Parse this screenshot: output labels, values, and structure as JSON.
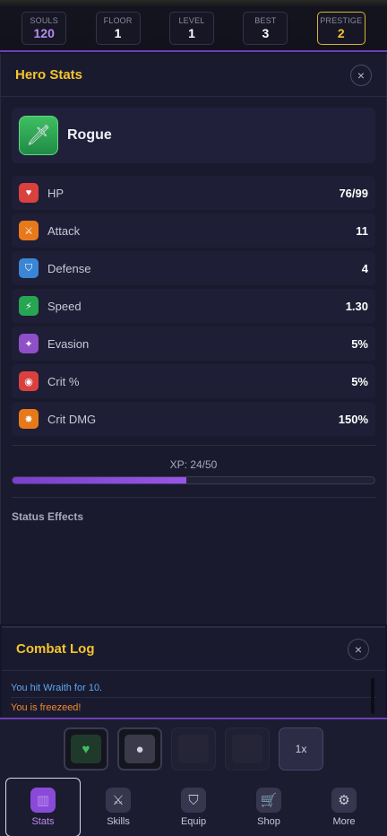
{
  "topbar": {
    "souls": {
      "label": "SOULS",
      "value": "120"
    },
    "floor": {
      "label": "FLOOR",
      "value": "1"
    },
    "level": {
      "label": "LEVEL",
      "value": "1"
    },
    "best": {
      "label": "BEST",
      "value": "3"
    },
    "prestige": {
      "label": "PRESTIGE",
      "value": "2"
    }
  },
  "hero_panel": {
    "title": "Hero Stats",
    "close_glyph": "×",
    "hero": {
      "name": "Rogue",
      "icon": "dagger-icon",
      "glyph": "🗡"
    },
    "stats": [
      {
        "name": "HP",
        "value": "76/99",
        "icon": "heart-icon",
        "glyph": "♥",
        "color": "#d9413f"
      },
      {
        "name": "Attack",
        "value": "11",
        "icon": "crossed-swords-icon",
        "glyph": "⚔",
        "color": "#e8791a"
      },
      {
        "name": "Defense",
        "value": "4",
        "icon": "shield-icon",
        "glyph": "⛉",
        "color": "#3a86d4"
      },
      {
        "name": "Speed",
        "value": "1.30",
        "icon": "lightning-icon",
        "glyph": "⚡",
        "color": "#27a552"
      },
      {
        "name": "Evasion",
        "value": "5%",
        "icon": "dash-icon",
        "glyph": "✦",
        "color": "#8e4fc8"
      },
      {
        "name": "Crit %",
        "value": "5%",
        "icon": "target-icon",
        "glyph": "◉",
        "color": "#d9413f"
      },
      {
        "name": "Crit DMG",
        "value": "150%",
        "icon": "burst-icon",
        "glyph": "✸",
        "color": "#e8791a"
      }
    ],
    "xp": {
      "label": "XP: 24/50",
      "current": 24,
      "max": 50
    },
    "status_effects_title": "Status Effects"
  },
  "combat_log": {
    "title": "Combat Log",
    "close_glyph": "×",
    "entries": [
      {
        "text": "You hit Wraith for 10."
      },
      {
        "text": "You is freezeed!"
      }
    ]
  },
  "quick_slots": [
    {
      "icon": "heart-potion-icon",
      "glyph": "♥",
      "state": "ready"
    },
    {
      "icon": "bomb-icon",
      "glyph": "●",
      "state": "ready"
    },
    {
      "icon": "empty-slot-icon",
      "glyph": "",
      "state": "locked"
    },
    {
      "icon": "empty-slot-icon",
      "glyph": "",
      "state": "locked"
    }
  ],
  "speed_button": {
    "label": "1x"
  },
  "nav": [
    {
      "label": "Stats",
      "icon": "bar-chart-icon",
      "glyph": "▥",
      "active": true
    },
    {
      "label": "Skills",
      "icon": "crossed-swords-icon",
      "glyph": "⚔",
      "active": false
    },
    {
      "label": "Equip",
      "icon": "shield-icon",
      "glyph": "⛉",
      "active": false
    },
    {
      "label": "Shop",
      "icon": "cart-icon",
      "glyph": "🛒",
      "active": false
    },
    {
      "label": "More",
      "icon": "gear-icon",
      "glyph": "⚙",
      "active": false
    }
  ],
  "colors": {
    "accent": "#f4c430",
    "purple": "#8a4ad8",
    "souls": "#b98cf2",
    "hit": "#5aa8f0",
    "status": "#f08a30"
  }
}
